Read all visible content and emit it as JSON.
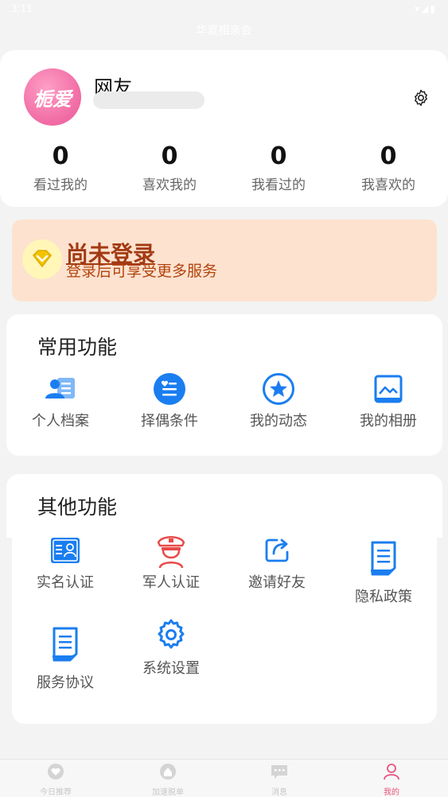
{
  "status_bar": {
    "time": "3:11",
    "right_icons": "▾◢▮"
  },
  "app_title": "华夏相亲会",
  "profile": {
    "avatar_text": "栀爱",
    "username": "网友"
  },
  "stats": [
    {
      "value": "0",
      "label": "看过我的"
    },
    {
      "value": "0",
      "label": "喜欢我的"
    },
    {
      "value": "0",
      "label": "我看过的"
    },
    {
      "value": "0",
      "label": "我喜欢的"
    }
  ],
  "login_banner": {
    "title": "尚未登录",
    "subtitle": "登录后可享受更多服务"
  },
  "common_functions": {
    "title": "常用功能",
    "items": [
      {
        "label": "个人档案",
        "icon": "profile-card-icon"
      },
      {
        "label": "择偶条件",
        "icon": "list-icon"
      },
      {
        "label": "我的动态",
        "icon": "star-icon"
      },
      {
        "label": "我的相册",
        "icon": "photo-album-icon"
      }
    ]
  },
  "other_functions": {
    "title": "其他功能",
    "items": [
      {
        "label": "实名认证",
        "icon": "id-card-icon"
      },
      {
        "label": "军人认证",
        "icon": "soldier-icon"
      },
      {
        "label": "邀请好友",
        "icon": "share-icon"
      },
      {
        "label": "隐私政策",
        "icon": "document-icon"
      },
      {
        "label": "服务协议",
        "icon": "document-icon"
      },
      {
        "label": "系统设置",
        "icon": "gear-icon"
      }
    ]
  },
  "tabbar": [
    {
      "label": "今日推荐",
      "icon": "heart-icon",
      "active": false
    },
    {
      "label": "加速脱单",
      "icon": "home-icon",
      "active": false
    },
    {
      "label": "消息",
      "icon": "message-icon",
      "active": false
    },
    {
      "label": "我的",
      "icon": "person-icon",
      "active": true
    }
  ],
  "colors": {
    "accent_blue": "#1a7ef0",
    "accent_pink": "#e8547e",
    "banner_bg": "#fde2cf",
    "banner_text": "#a23a13"
  }
}
